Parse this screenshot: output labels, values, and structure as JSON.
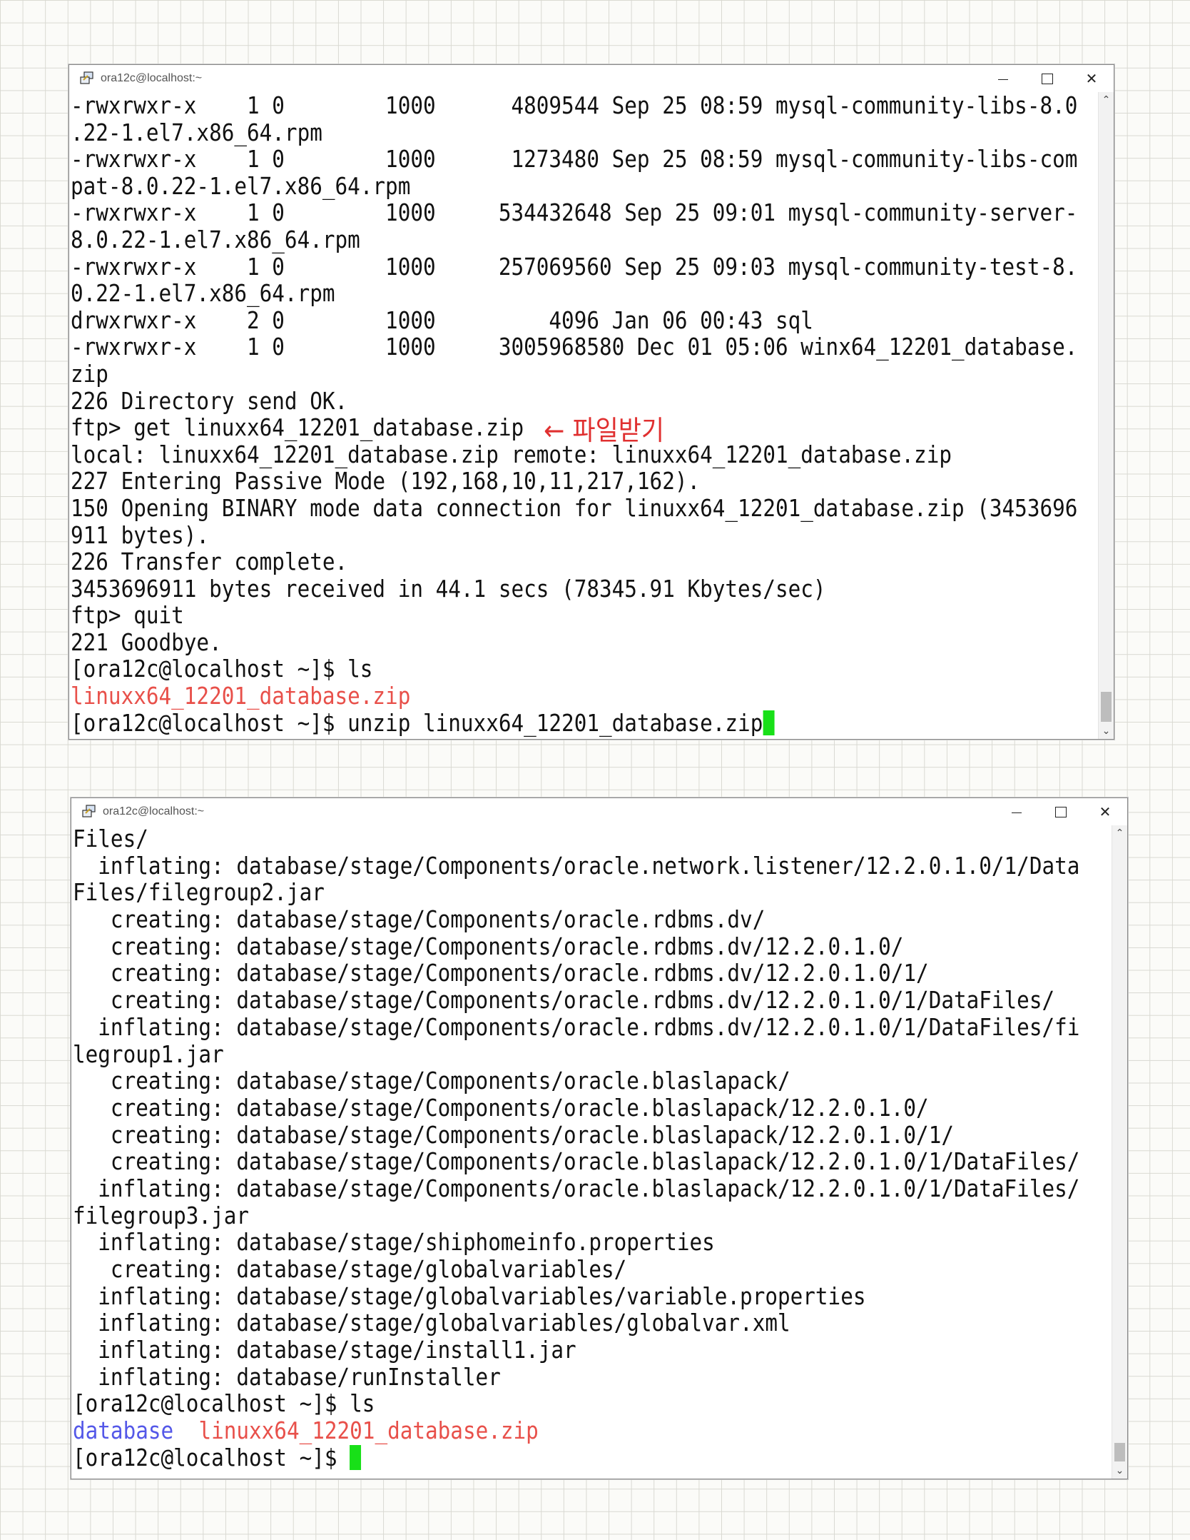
{
  "window1": {
    "title": "ora12c@localhost:~",
    "lines": [
      {
        "text": "-rwxrwxr-x    1 0        1000      4809544 Sep 25 08:59 mysql-community-libs-8.0"
      },
      {
        "text": ".22-1.el7.x86_64.rpm"
      },
      {
        "text": "-rwxrwxr-x    1 0        1000      1273480 Sep 25 08:59 mysql-community-libs-com"
      },
      {
        "text": "pat-8.0.22-1.el7.x86_64.rpm"
      },
      {
        "text": "-rwxrwxr-x    1 0        1000     534432648 Sep 25 09:01 mysql-community-server-"
      },
      {
        "text": "8.0.22-1.el7.x86_64.rpm"
      },
      {
        "text": "-rwxrwxr-x    1 0        1000     257069560 Sep 25 09:03 mysql-community-test-8."
      },
      {
        "text": "0.22-1.el7.x86_64.rpm"
      },
      {
        "text": "drwxrwxr-x    2 0        1000         4096 Jan 06 00:43 sql"
      },
      {
        "text": "-rwxrwxr-x    1 0        1000     3005968580 Dec 01 05:06 winx64_12201_database."
      },
      {
        "text": "zip"
      },
      {
        "text": "226 Directory send OK."
      },
      {
        "text": "ftp> get linuxx64_12201_database.zip"
      },
      {
        "text": "local: linuxx64_12201_database.zip remote: linuxx64_12201_database.zip"
      },
      {
        "text": "227 Entering Passive Mode (192,168,10,11,217,162)."
      },
      {
        "text": "150 Opening BINARY mode data connection for linuxx64_12201_database.zip (3453696"
      },
      {
        "text": "911 bytes)."
      },
      {
        "text": "226 Transfer complete."
      },
      {
        "text": "3453696911 bytes received in 44.1 secs (78345.91 Kbytes/sec)"
      },
      {
        "text": "ftp> quit"
      },
      {
        "text": "221 Goodbye."
      },
      {
        "text": "[ora12c@localhost ~]$ ls"
      },
      {
        "text": "linuxx64_12201_database.zip",
        "color": "red"
      },
      {
        "text": "[ora12c@localhost ~]$ unzip linuxx64_12201_database.zip",
        "cursor": true
      }
    ],
    "annotation": "← 파일받기"
  },
  "window2": {
    "title": "ora12c@localhost:~",
    "lines": [
      {
        "text": "Files/"
      },
      {
        "text": "  inflating: database/stage/Components/oracle.network.listener/12.2.0.1.0/1/Data"
      },
      {
        "text": "Files/filegroup2.jar"
      },
      {
        "text": "   creating: database/stage/Components/oracle.rdbms.dv/"
      },
      {
        "text": "   creating: database/stage/Components/oracle.rdbms.dv/12.2.0.1.0/"
      },
      {
        "text": "   creating: database/stage/Components/oracle.rdbms.dv/12.2.0.1.0/1/"
      },
      {
        "text": "   creating: database/stage/Components/oracle.rdbms.dv/12.2.0.1.0/1/DataFiles/"
      },
      {
        "text": "  inflating: database/stage/Components/oracle.rdbms.dv/12.2.0.1.0/1/DataFiles/fi"
      },
      {
        "text": "legroup1.jar"
      },
      {
        "text": "   creating: database/stage/Components/oracle.blaslapack/"
      },
      {
        "text": "   creating: database/stage/Components/oracle.blaslapack/12.2.0.1.0/"
      },
      {
        "text": "   creating: database/stage/Components/oracle.blaslapack/12.2.0.1.0/1/"
      },
      {
        "text": "   creating: database/stage/Components/oracle.blaslapack/12.2.0.1.0/1/DataFiles/"
      },
      {
        "text": "  inflating: database/stage/Components/oracle.blaslapack/12.2.0.1.0/1/DataFiles/"
      },
      {
        "text": "filegroup3.jar"
      },
      {
        "text": "  inflating: database/stage/shiphomeinfo.properties"
      },
      {
        "text": "   creating: database/stage/globalvariables/"
      },
      {
        "text": "  inflating: database/stage/globalvariables/variable.properties"
      },
      {
        "text": "  inflating: database/stage/globalvariables/globalvar.xml"
      },
      {
        "text": "  inflating: database/stage/install1.jar"
      },
      {
        "text": "  inflating: database/runInstaller"
      },
      {
        "text": "[ora12c@localhost ~]$ ls"
      },
      {
        "segments": [
          {
            "text": "database",
            "color": "blue"
          },
          {
            "text": "  "
          },
          {
            "text": "linuxx64_12201_database.zip",
            "color": "red"
          }
        ]
      },
      {
        "text": "[ora12c@localhost ~]$ ",
        "cursor": true
      }
    ]
  },
  "colors": {
    "cursor": "#18e018",
    "red_text": "#e8504a",
    "blue_text": "#5458e8",
    "annotation": "#e03030"
  },
  "icons": [
    "putty-icon",
    "minimize-icon",
    "maximize-icon",
    "close-icon",
    "scroll-up-arrow-icon",
    "scroll-down-arrow-icon"
  ]
}
